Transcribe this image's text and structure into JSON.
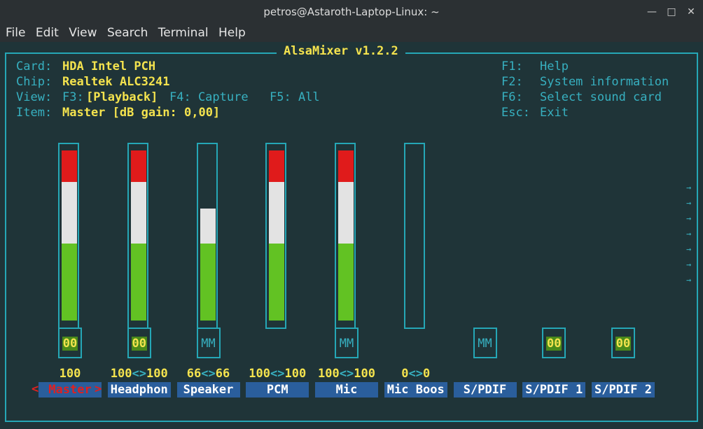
{
  "window": {
    "title": "petros@Astaroth-Laptop-Linux: ~"
  },
  "menu": [
    "File",
    "Edit",
    "View",
    "Search",
    "Terminal",
    "Help"
  ],
  "app": {
    "title": "AlsaMixer v1.2.2",
    "card_label": "Card:",
    "card": "HDA Intel PCH",
    "chip_label": "Chip:",
    "chip": "Realtek ALC3241",
    "view_label": "View:",
    "view_f3": "F3:",
    "view_playback": "[Playback]",
    "view_f4": "F4: Capture",
    "view_f5": "F5: All",
    "item_label": "Item:",
    "item": "Master [dB gain: 0,00]",
    "keys": [
      {
        "key": "F1:",
        "action": "Help"
      },
      {
        "key": "F2:",
        "action": "System information"
      },
      {
        "key": "F6:",
        "action": "Select sound card"
      },
      {
        "key": "Esc:",
        "action": "Exit"
      }
    ]
  },
  "channels": [
    {
      "name": "Master",
      "level": 100,
      "switch": "00",
      "volume_l": "100",
      "volume_sep": "",
      "volume_r": "",
      "selected": true
    },
    {
      "name": "Headphon",
      "level": 100,
      "switch": "00",
      "volume_l": "100",
      "volume_sep": "<>",
      "volume_r": "100",
      "selected": false
    },
    {
      "name": "Speaker",
      "level": 66,
      "switch": "MM",
      "volume_l": "66",
      "volume_sep": "<>",
      "volume_r": "66",
      "selected": false
    },
    {
      "name": "PCM",
      "level": 100,
      "switch": "",
      "volume_l": "100",
      "volume_sep": "<>",
      "volume_r": "100",
      "selected": false
    },
    {
      "name": "Mic",
      "level": 100,
      "switch": "MM",
      "volume_l": "100",
      "volume_sep": "<>",
      "volume_r": "100",
      "selected": false
    },
    {
      "name": "Mic Boos",
      "level": 0,
      "switch": "",
      "volume_l": "0",
      "volume_sep": "<>",
      "volume_r": "0",
      "selected": false
    },
    {
      "name": "S/PDIF",
      "level": null,
      "switch": "MM",
      "volume_l": "",
      "volume_sep": "",
      "volume_r": "",
      "selected": false
    },
    {
      "name": "S/PDIF 1",
      "level": null,
      "switch": "00",
      "volume_l": "",
      "volume_sep": "",
      "volume_r": "",
      "selected": false
    },
    {
      "name": "S/PDIF 2",
      "level": null,
      "switch": "00",
      "volume_l": "",
      "volume_sep": "",
      "volume_r": "",
      "selected": false
    }
  ],
  "select_marker_left": "<",
  "select_marker_right": ">",
  "scroll_arrow": "→",
  "colors": {
    "red": "#e01b1b",
    "white": "#e3e3e3",
    "green": "#62c223",
    "border": "#25a7b6"
  }
}
